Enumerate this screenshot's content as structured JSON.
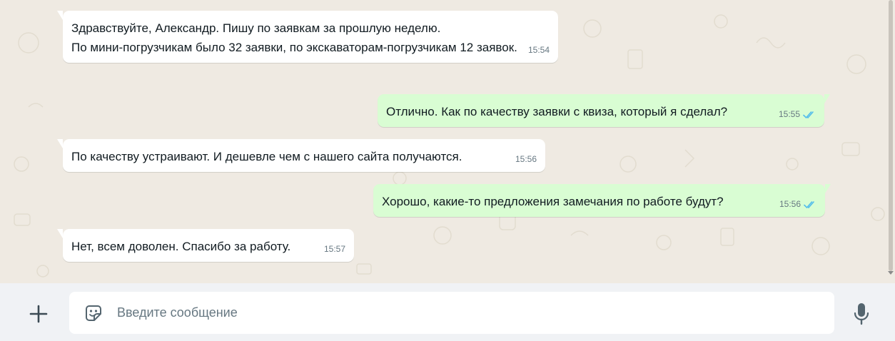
{
  "colors": {
    "chat_background": "#efeae2",
    "incoming_bubble": "#ffffff",
    "outgoing_bubble": "#d9fdd3",
    "read_ticks": "#53bdeb",
    "timestamp": "#667781",
    "composer_bar": "#f0f2f5"
  },
  "messages": [
    {
      "direction": "incoming",
      "text": "Здравствуйте, Александр. Пишу по заявкам за прошлую неделю.\nПо мини-погрузчикам было 32 заявки, по экскаваторам-погрузчикам 12 заявок.",
      "time": "15:54"
    },
    {
      "direction": "outgoing",
      "text": "Отлично. Как по качеству заявки с квиза, который я сделал?",
      "time": "15:55",
      "status": "read"
    },
    {
      "direction": "incoming",
      "text": "По качеству устраивают. И дешевле чем с нашего сайта получаются.",
      "time": "15:56"
    },
    {
      "direction": "outgoing",
      "text": "Хорошо, какие-то предложения замечания по работе будут?",
      "time": "15:56",
      "status": "read"
    },
    {
      "direction": "incoming",
      "text": "Нет, всем доволен. Спасибо за работу.",
      "time": "15:57"
    }
  ],
  "composer": {
    "placeholder": "Введите сообщение",
    "attach_icon": "plus-icon",
    "sticker_icon": "sticker-icon",
    "voice_icon": "microphone-icon"
  }
}
